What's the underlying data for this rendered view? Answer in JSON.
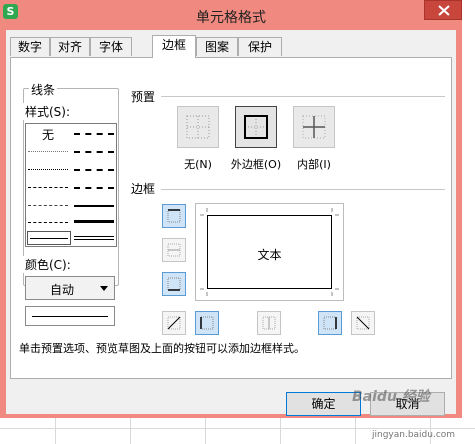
{
  "window": {
    "title": "单元格格式",
    "app_icon_letter": "S"
  },
  "tabs": [
    {
      "label": "数字"
    },
    {
      "label": "对齐"
    },
    {
      "label": "字体"
    },
    {
      "label": "边框",
      "active": true
    },
    {
      "label": "图案"
    },
    {
      "label": "保护"
    }
  ],
  "line_group": {
    "title": "线条",
    "style_label": "样式(S):",
    "none_label": "无",
    "color_label": "颜色(C):",
    "color_value": "自动"
  },
  "preset_group": {
    "title": "预置",
    "buttons": [
      {
        "label": "无(N)"
      },
      {
        "label": "外边框(O)"
      },
      {
        "label": "内部(I)"
      }
    ]
  },
  "border_group": {
    "title": "边框",
    "preview_text": "文本"
  },
  "hint": "单击预置选项、预览草图及上面的按钮可以添加边框样式。",
  "buttons": {
    "ok": "确定",
    "cancel": "取消"
  },
  "watermark": {
    "text": "Baidu 经验",
    "url": "jingyan.baidu.com"
  },
  "colors": {
    "title_bar": "#f08a80",
    "close_button": "#c9463d",
    "active_toggle": "#cfe4f7"
  },
  "icons": [
    "close-icon",
    "border-left-icon",
    "border-inside-horizontal-icon",
    "border-bottom-icon",
    "diagonal-up-icon",
    "border-left-vertical-icon",
    "border-inside-vertical-icon",
    "border-right-icon",
    "diagonal-down-icon"
  ]
}
